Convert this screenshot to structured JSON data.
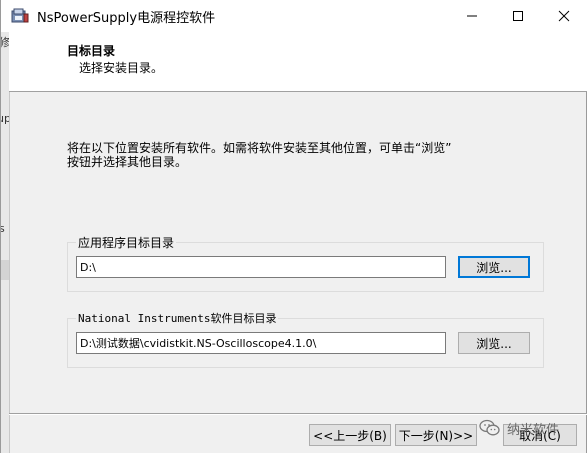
{
  "window": {
    "title": "NsPowerSupply电源程控软件"
  },
  "left_strip": {
    "fragments": [
      "修",
      "up",
      "s"
    ]
  },
  "header": {
    "title": "目标目录",
    "subtitle": "选择安装目录。"
  },
  "intro": {
    "line1": "将在以下位置安装所有软件。如需将软件安装至其他位置，可单击“浏览”",
    "line2": "按钮并选择其他目录。"
  },
  "app_dir": {
    "label": "应用程序目标目录",
    "value": "D:\\",
    "browse_label": "浏览..."
  },
  "ni_dir": {
    "label": "National Instruments软件目标目录",
    "value": "D:\\测试数据\\cvidistkit.NS-Oscilloscope4.1.0\\",
    "browse_label": "浏览..."
  },
  "footer": {
    "back_label": "<<上一步(B)",
    "next_label": "下一步(N)>>",
    "cancel_label": "取消(C)"
  },
  "watermark": {
    "text": "纳米软件"
  }
}
